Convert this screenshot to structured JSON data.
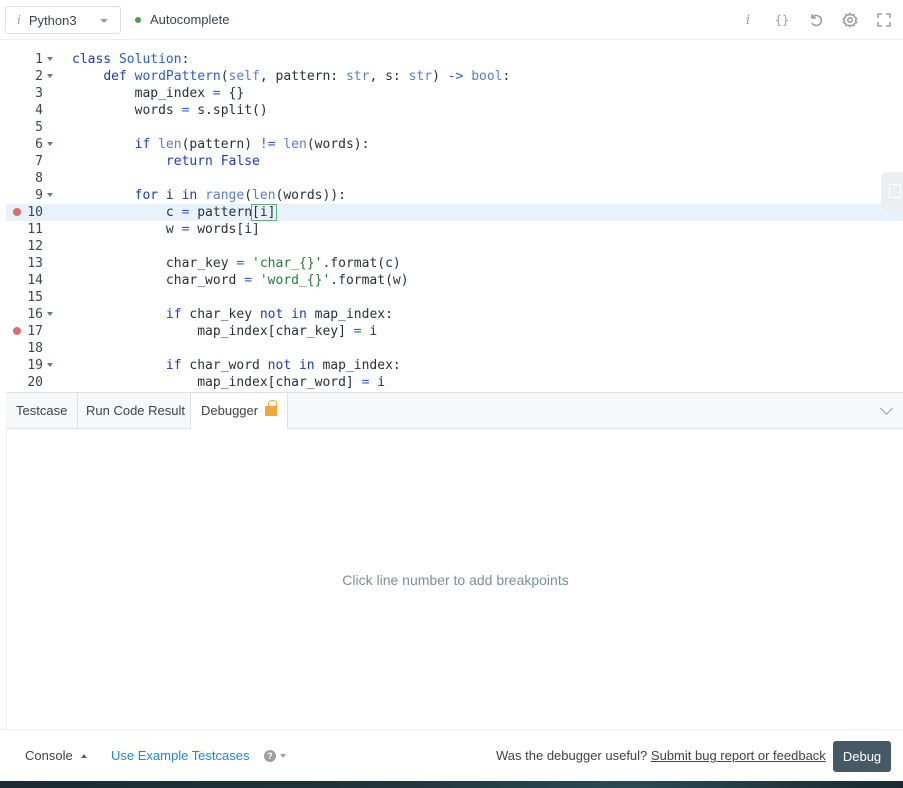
{
  "toolbar": {
    "language_icon": "i",
    "language": "Python3",
    "autocomplete_label": "Autocomplete",
    "icons": [
      "info-icon",
      "braces-icon",
      "reset-icon",
      "settings-icon",
      "fullscreen-icon"
    ],
    "braces_glyph": "{}",
    "info_glyph": "i"
  },
  "editor": {
    "line_numbers": [
      "1",
      "2",
      "3",
      "4",
      "5",
      "6",
      "7",
      "8",
      "9",
      "10",
      "11",
      "12",
      "13",
      "14",
      "15",
      "16",
      "17",
      "18",
      "19",
      "20"
    ],
    "folded_lines": [
      1,
      2,
      6,
      9,
      16,
      19
    ],
    "breakpoint_lines": [
      10,
      17
    ],
    "active_line": 10,
    "code_lines": [
      "class Solution:",
      "    def wordPattern(self, pattern: str, s: str) -> bool:",
      "        map_index = {}",
      "        words = s.split()",
      "",
      "        if len(pattern) != len(words):",
      "            return False",
      "",
      "        for i in range(len(words)):",
      "            c = pattern[i]",
      "            w = words[i]",
      "",
      "            char_key = 'char_{}'.format(c)",
      "            char_word = 'word_{}'.format(w)",
      "",
      "            if char_key not in map_index:",
      "                map_index[char_key] = i",
      "",
      "            if char_word not in map_index:",
      "                map_index[char_word] = i"
    ]
  },
  "panel": {
    "tabs": [
      {
        "label": "Testcase"
      },
      {
        "label": "Run Code Result"
      },
      {
        "label": "Debugger",
        "active": true
      }
    ],
    "debugger_hint": "Click line number to add breakpoints"
  },
  "footer": {
    "console_label": "Console",
    "use_example_label": "Use Example Testcases",
    "help_glyph": "?",
    "feedback_prefix": "Was the debugger useful?",
    "feedback_link": "Submit bug report or feedback",
    "debug_button": "Debug"
  },
  "colors": {
    "accent_link": "#1f88d6",
    "debug_button_bg": "#455a64",
    "breakpoint": "#d9534f",
    "active_line_bg": "#e8f2fc",
    "autocomplete_dot": "#43a047",
    "lock": "#f0a833"
  }
}
